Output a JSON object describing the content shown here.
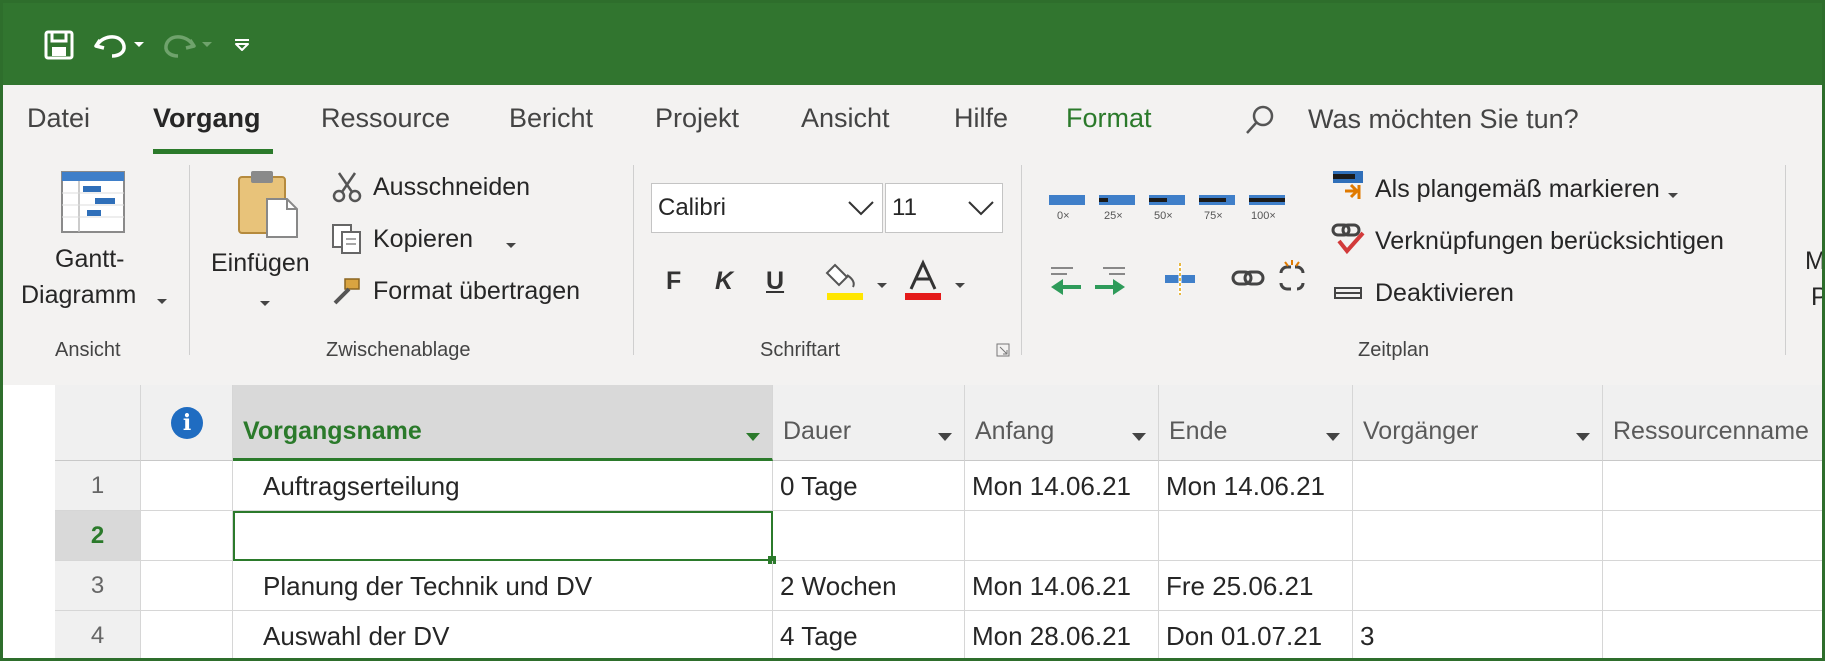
{
  "menu": {
    "tabs": [
      "Datei",
      "Vorgang",
      "Ressource",
      "Bericht",
      "Projekt",
      "Ansicht",
      "Hilfe",
      "Format"
    ],
    "search_placeholder": "Was möchten Sie tun?"
  },
  "ribbon": {
    "view": {
      "gantt_line1": "Gantt-",
      "gantt_line2": "Diagramm",
      "group_label": "Ansicht"
    },
    "clipboard": {
      "paste": "Einfügen",
      "cut": "Ausschneiden",
      "copy": "Kopieren",
      "format_painter": "Format übertragen",
      "group_label": "Zwischenablage"
    },
    "font": {
      "family": "Calibri",
      "size": "11",
      "bold": "F",
      "italic": "K",
      "underline": "U",
      "group_label": "Schriftart"
    },
    "schedule": {
      "progress_labels": [
        "0×",
        "25×",
        "50×",
        "75×",
        "100×"
      ],
      "mark_on_track": "Als plangemäß markieren",
      "respect_links": "Verknüpfungen berücksichtigen",
      "deactivate": "Deaktivieren",
      "group_label": "Zeitplan"
    },
    "overflow_letters": {
      "first": "M",
      "second": "P"
    }
  },
  "grid": {
    "columns": [
      "Vorgangsname",
      "Dauer",
      "Anfang",
      "Ende",
      "Vorgänger",
      "Ressourcenname"
    ],
    "rows": [
      {
        "num": "1",
        "name": "Auftragserteilung",
        "duration": "0 Tage",
        "start": "Mon 14.06.21",
        "end": "Mon 14.06.21",
        "pred": ""
      },
      {
        "num": "2",
        "name": "",
        "duration": "",
        "start": "",
        "end": "",
        "pred": ""
      },
      {
        "num": "3",
        "name": "Planung der Technik und DV",
        "duration": "2 Wochen",
        "start": "Mon 14.06.21",
        "end": "Fre 25.06.21",
        "pred": ""
      },
      {
        "num": "4",
        "name": "Auswahl der DV",
        "duration": "4 Tage",
        "start": "Mon 28.06.21",
        "end": "Don 01.07.21",
        "pred": "3"
      }
    ]
  },
  "colors": {
    "titlebar": "#31752f",
    "accent": "#2b7a2b",
    "info": "#1f6cc1"
  }
}
